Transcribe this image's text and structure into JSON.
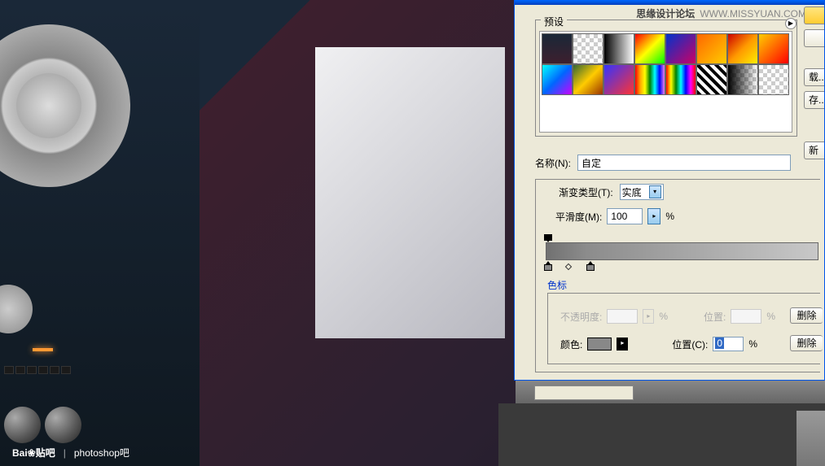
{
  "watermark_top": {
    "brand": "思缘设计论坛",
    "url": "WWW.MISSYUAN.COM"
  },
  "watermark_bottom": {
    "logo": "Bai❀贴吧",
    "text": "photoshop吧"
  },
  "dialog": {
    "presets_label": "预设",
    "buttons": {
      "ok": "",
      "cancel": "",
      "load": "载...",
      "save": "存...",
      "new": "新"
    },
    "name_label": "名称(N):",
    "name_value": "自定",
    "type_label": "渐变类型(T):",
    "type_value": "实底",
    "smooth_label": "平滑度(M):",
    "smooth_value": "100",
    "percent": "%",
    "stops_label": "色标",
    "opacity_label": "不透明度:",
    "position_label": "位置:",
    "color_label": "颜色:",
    "position_c_label": "位置(C):",
    "position_c_value": "0",
    "delete_label": "删除"
  }
}
